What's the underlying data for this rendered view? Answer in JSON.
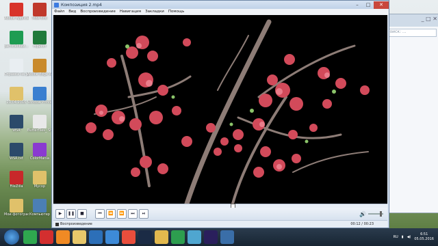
{
  "window": {
    "title": "Композиция 2.mp4",
    "controls": {
      "minimize": "–",
      "maximize": "□",
      "close": "✕"
    }
  },
  "menu": [
    "Файл",
    "Вид",
    "Воспроизведение",
    "Навигация",
    "Закладки",
    "Помощь"
  ],
  "player": {
    "status_text": "Воспроизведение",
    "time": "00:12 / 00:23",
    "progress": 0.53
  },
  "transport": [
    {
      "name": "play-button",
      "icon": "play-icon",
      "glyph": "▶"
    },
    {
      "name": "pause-button",
      "icon": "pause-icon",
      "glyph": "❚❚"
    },
    {
      "name": "stop-button",
      "icon": "stop-icon",
      "glyph": "■"
    },
    {
      "name": "prev-button",
      "icon": "skip-back-icon",
      "glyph": "⏮"
    },
    {
      "name": "rewind-button",
      "icon": "rewind-icon",
      "glyph": "⏪"
    },
    {
      "name": "forward-button",
      "icon": "fast-forward-icon",
      "glyph": "⏩"
    },
    {
      "name": "next-button",
      "icon": "skip-forward-icon",
      "glyph": "⏭"
    },
    {
      "name": "frame-step-button",
      "icon": "frame-step-icon",
      "glyph": "⏯"
    }
  ],
  "desktop_icons": [
    {
      "label": "Adobe Applicati...",
      "color": "#d8342a"
    },
    {
      "label": "Мой бло",
      "color": "#c0392b"
    },
    {
      "label": "particleIllust... 3.0",
      "color": "#1e9c52"
    },
    {
      "label": "mp2ion",
      "color": "#1f7a3a"
    },
    {
      "label": "Справка на русском",
      "color": "#e9eef2"
    },
    {
      "label": "Adobe Edge Animate C...",
      "color": "#c98a2c"
    },
    {
      "label": "21.04.2016",
      "color": "#e0c16a"
    },
    {
      "label": "Window Printerit",
      "color": "#3a7fd0"
    },
    {
      "label": "WSR",
      "color": "#2c4a6a"
    },
    {
      "label": "Butterflies_ Shane",
      "color": "#e8e8e8"
    },
    {
      "label": "WSR.txt",
      "color": "#2c4a6a"
    },
    {
      "label": "ColorMania",
      "color": "#8a3ad0"
    },
    {
      "label": "FileZilla",
      "color": "#c8282a"
    },
    {
      "label": "Мусор",
      "color": "#e0c16a"
    },
    {
      "label": "Мои фотографии",
      "color": "#e0c16a"
    },
    {
      "label": "Компьютер",
      "color": "#4b7fb5"
    }
  ],
  "explorer": {
    "search_placeholder": "Поиск: ..."
  },
  "taskbar": {
    "apps": [
      {
        "name": "chrome-taskbar-icon",
        "color": "#2fa84f"
      },
      {
        "name": "opera-taskbar-icon",
        "color": "#d32f2f"
      },
      {
        "name": "firefox-taskbar-icon",
        "color": "#f08a24"
      },
      {
        "name": "explorer-taskbar-icon",
        "color": "#e7c76a"
      },
      {
        "name": "media-taskbar-icon",
        "color": "#2c6fb8"
      },
      {
        "name": "ie-taskbar-icon",
        "color": "#3d8ad8"
      },
      {
        "name": "chrome2-taskbar-icon",
        "color": "#e94e3c"
      },
      {
        "name": "photoshop-taskbar-icon",
        "color": "#1b2b45"
      },
      {
        "name": "folder-taskbar-icon",
        "color": "#e2b94e"
      },
      {
        "name": "camtasia-taskbar-icon",
        "color": "#2d9e4f"
      },
      {
        "name": "app-taskbar-icon",
        "color": "#4fa6d0"
      },
      {
        "name": "aftereffects-taskbar-icon",
        "color": "#2a1f5c"
      },
      {
        "name": "player-taskbar-icon",
        "color": "#3a6ea8"
      }
    ],
    "lang": "RU",
    "time": "6:51",
    "date": "05.05.2016"
  }
}
